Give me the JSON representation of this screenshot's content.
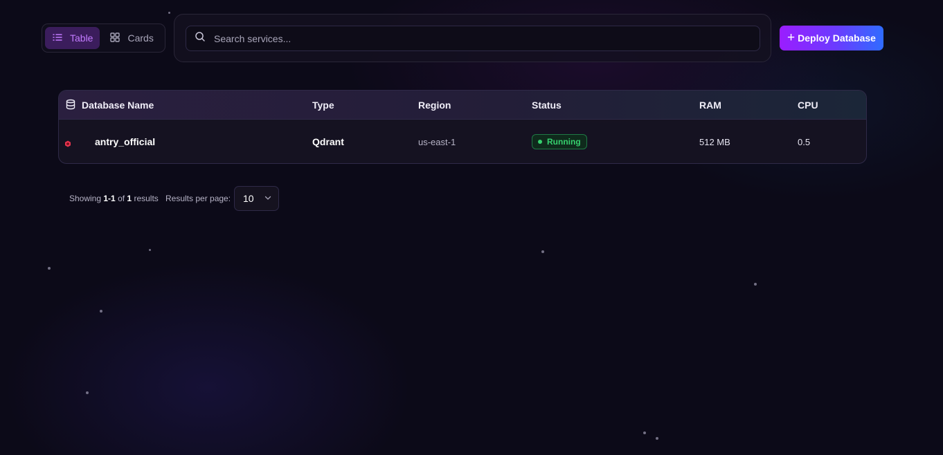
{
  "view_toggle": {
    "table_label": "Table",
    "cards_label": "Cards",
    "active": "Table"
  },
  "search": {
    "placeholder": "Search services...",
    "value": ""
  },
  "deploy_button": {
    "label": "Deploy Database"
  },
  "table": {
    "columns": {
      "name": "Database Name",
      "type": "Type",
      "region": "Region",
      "status": "Status",
      "ram": "RAM",
      "cpu": "CPU"
    },
    "rows": [
      {
        "name": "antry_official",
        "type": "Qdrant",
        "region": "us-east-1",
        "status": "Running",
        "ram": "512 MB",
        "cpu": "0.5"
      }
    ]
  },
  "pagination": {
    "showing_prefix": "Showing",
    "range": "1-1",
    "of": "of",
    "total": "1",
    "results": "results",
    "per_page_label": "Results per page:",
    "per_page_value": "10"
  },
  "colors": {
    "background": "#0c0a18",
    "accent_purple": "#9a1dff",
    "accent_blue": "#2f6cff",
    "status_running": "#36d06e"
  }
}
